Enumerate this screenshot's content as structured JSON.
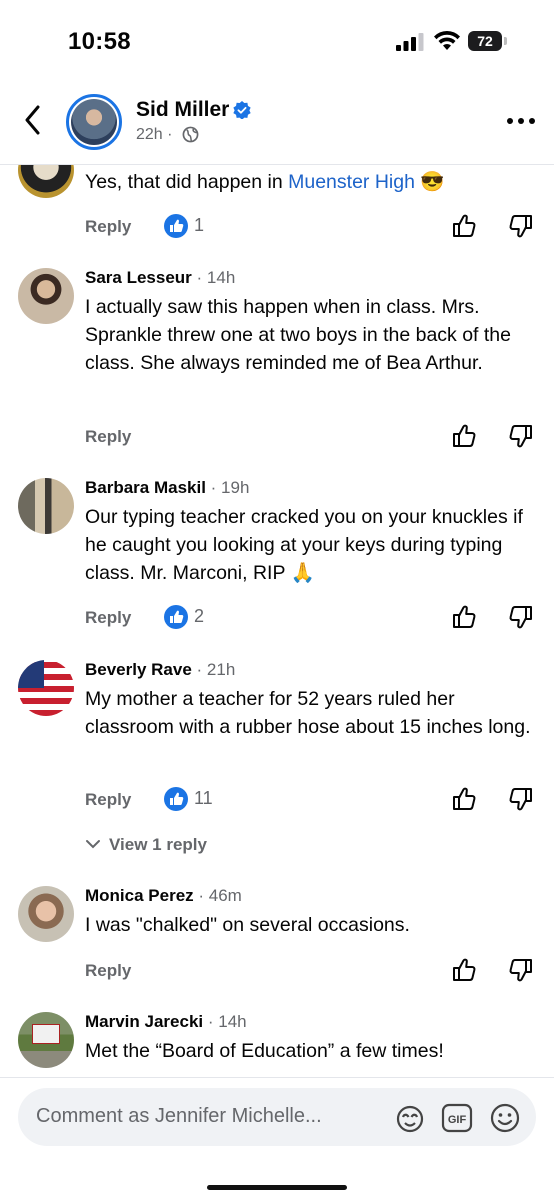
{
  "status": {
    "time": "10:58",
    "battery": "72"
  },
  "header": {
    "name": "Sid Miller",
    "time": "22h ·"
  },
  "comments": [
    {
      "name": "",
      "time": "",
      "text_plain": "Yes, that did happen in ",
      "text_link": "Muenster High",
      "emoji": "😎",
      "reply": "Reply",
      "likes": "1"
    },
    {
      "name": "Sara Lesseur",
      "time": " · 14h",
      "text": "I actually saw this happen when in class. Mrs. Sprankle threw one at two boys in the back of the class. She always reminded me of Bea Arthur.",
      "reply": "Reply"
    },
    {
      "name": "Barbara Maskil",
      "time": " · 19h",
      "text": "Our typing teacher cracked you on your knuckles if he caught you looking at your keys during typing class. Mr. Marconi, RIP 🙏",
      "reply": "Reply",
      "likes": "2"
    },
    {
      "name": "Beverly Rave",
      "time": " · 21h",
      "text": "My mother a teacher for 52 years ruled her classroom with a rubber hose about 15 inches long.",
      "reply": "Reply",
      "likes": "11",
      "view_replies": "View 1 reply"
    },
    {
      "name": "Monica Perez",
      "time": " · 46m",
      "text": "I was \"chalked\" on several occasions.",
      "reply": "Reply"
    },
    {
      "name": "Marvin Jarecki",
      "time": " · 14h",
      "text": "Met the “Board of Education” a few times!"
    }
  ],
  "composer": {
    "placeholder": "Comment as Jennifer Michelle..."
  },
  "icons": {
    "back": "chevron-left-icon",
    "verified": "verified-badge-icon",
    "globe": "globe-icon",
    "more": "more-icon",
    "like": "like-icon",
    "dislike": "dislike-icon",
    "avatar_sticker": "sticker-icon",
    "gif": "gif-icon",
    "emoji": "emoji-icon"
  },
  "colors": {
    "link": "#1d63c9",
    "like_badge": "#1b74e4",
    "muted": "#65676b"
  }
}
